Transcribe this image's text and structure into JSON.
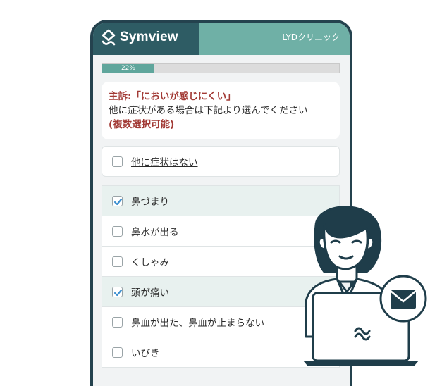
{
  "header": {
    "brand_name": "Symview",
    "clinic_name": "LYDクリニック",
    "logo_icon": "symview-logo-icon",
    "accent_color": "#2e5c64",
    "bar_color": "#6fb0a6"
  },
  "progress": {
    "label": "22%",
    "value": 0.22
  },
  "question": {
    "line1": "主訴:「においが感じにくい」",
    "line2": "他に症状がある場合は下記より選んでください",
    "line3": "(複数選択可能)"
  },
  "none_option": {
    "label": "他に症状はない",
    "checked": false
  },
  "options": [
    {
      "label": "鼻づまり",
      "checked": true
    },
    {
      "label": "鼻水が出る",
      "checked": false
    },
    {
      "label": "くしゃみ",
      "checked": false
    },
    {
      "label": "頭が痛い",
      "checked": true
    },
    {
      "label": "鼻血が出た、鼻血が止まらない",
      "checked": false
    },
    {
      "label": "いびき",
      "checked": false
    }
  ]
}
